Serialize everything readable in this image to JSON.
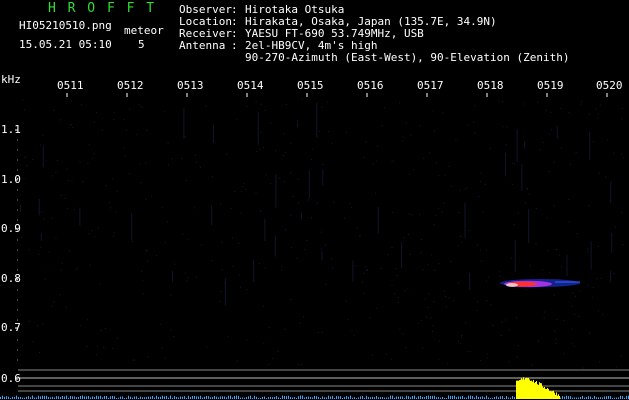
{
  "header": {
    "logo": "H R O F F T",
    "filename": "HI05210510.png",
    "datetime": "15.05.21 05:10",
    "meteor_label": "meteor",
    "meteor_count": "5",
    "info_labels": [
      "Observer",
      "Location",
      "Receiver",
      "Antenna",
      ""
    ],
    "info_values": [
      "Hirotaka Otsuka",
      "Hirakata, Osaka, Japan (135.7E, 34.9N)",
      "YAESU FT-690 53.749MHz, USB",
      "2el-HB9CV, 4m's high",
      "90-270-Azimuth (East-West), 90-Elevation (Zenith)"
    ]
  },
  "axis": {
    "unit": "kHz",
    "y_ticks": [
      "1.1",
      "1.0",
      "0.9",
      "0.8",
      "0.7",
      "0.6"
    ],
    "x_ticks": [
      "0511",
      "0512",
      "0513",
      "0514",
      "0515",
      "0516",
      "0517",
      "0518",
      "0519",
      "0520"
    ]
  },
  "colors": {
    "background": "#000000",
    "text": "#ffffff",
    "logo": "#33dd33",
    "noise": "#141a33",
    "echo_core": "#ff3030",
    "echo_edge": "#2040ff",
    "spectrum": "#ffff00"
  },
  "meteor_echo": {
    "time": "0518-0519",
    "frequency_khz": 0.79
  }
}
